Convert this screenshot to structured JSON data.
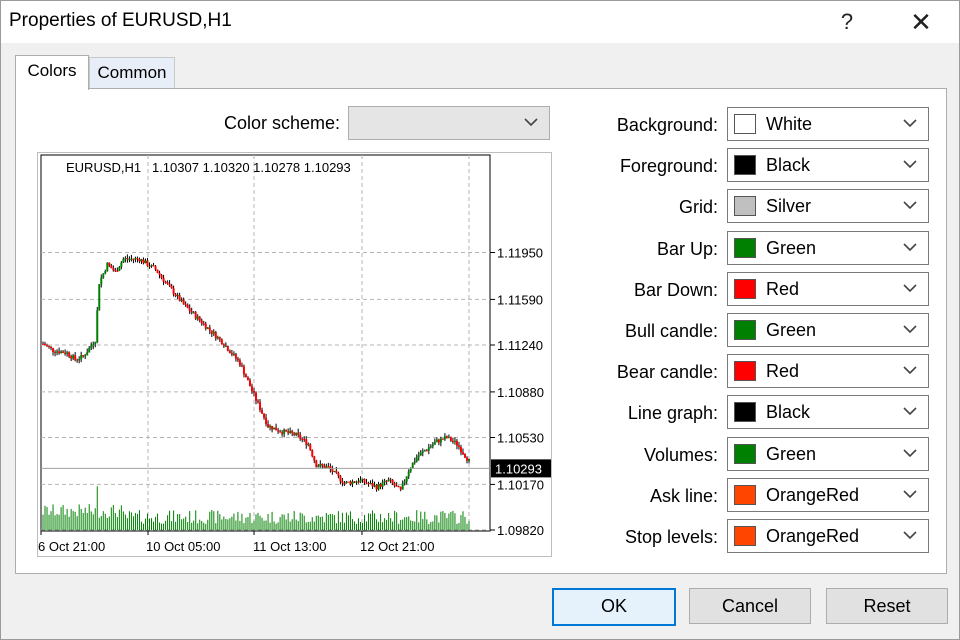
{
  "window": {
    "title": "Properties of EURUSD,H1",
    "help_label": "?",
    "close_label": "✕"
  },
  "tabs": [
    {
      "label": "Colors"
    },
    {
      "label": "Common"
    }
  ],
  "color_scheme": {
    "label": "Color scheme:",
    "value": ""
  },
  "chart": {
    "header": "EURUSD,H1   1.10307 1.10320 1.10278 1.10293",
    "price_labels": [
      "1.11950",
      "1.11590",
      "1.11240",
      "1.10880",
      "1.10530",
      "1.10170",
      "1.09820"
    ],
    "current_price": "1.10293",
    "time_labels": [
      "6 Oct 21:00",
      "10 Oct 05:00",
      "11 Oct 13:00",
      "12 Oct 21:00"
    ]
  },
  "properties": [
    {
      "label": "Background:",
      "value": "White",
      "color": "#ffffff"
    },
    {
      "label": "Foreground:",
      "value": "Black",
      "color": "#000000"
    },
    {
      "label": "Grid:",
      "value": "Silver",
      "color": "#c0c0c0"
    },
    {
      "label": "Bar Up:",
      "value": "Green",
      "color": "#008000"
    },
    {
      "label": "Bar Down:",
      "value": "Red",
      "color": "#ff0000"
    },
    {
      "label": "Bull candle:",
      "value": "Green",
      "color": "#008000"
    },
    {
      "label": "Bear candle:",
      "value": "Red",
      "color": "#ff0000"
    },
    {
      "label": "Line graph:",
      "value": "Black",
      "color": "#000000"
    },
    {
      "label": "Volumes:",
      "value": "Green",
      "color": "#008000"
    },
    {
      "label": "Ask line:",
      "value": "OrangeRed",
      "color": "#ff4500"
    },
    {
      "label": "Stop levels:",
      "value": "OrangeRed",
      "color": "#ff4500"
    }
  ],
  "buttons": {
    "ok": "OK",
    "cancel": "Cancel",
    "reset": "Reset"
  }
}
